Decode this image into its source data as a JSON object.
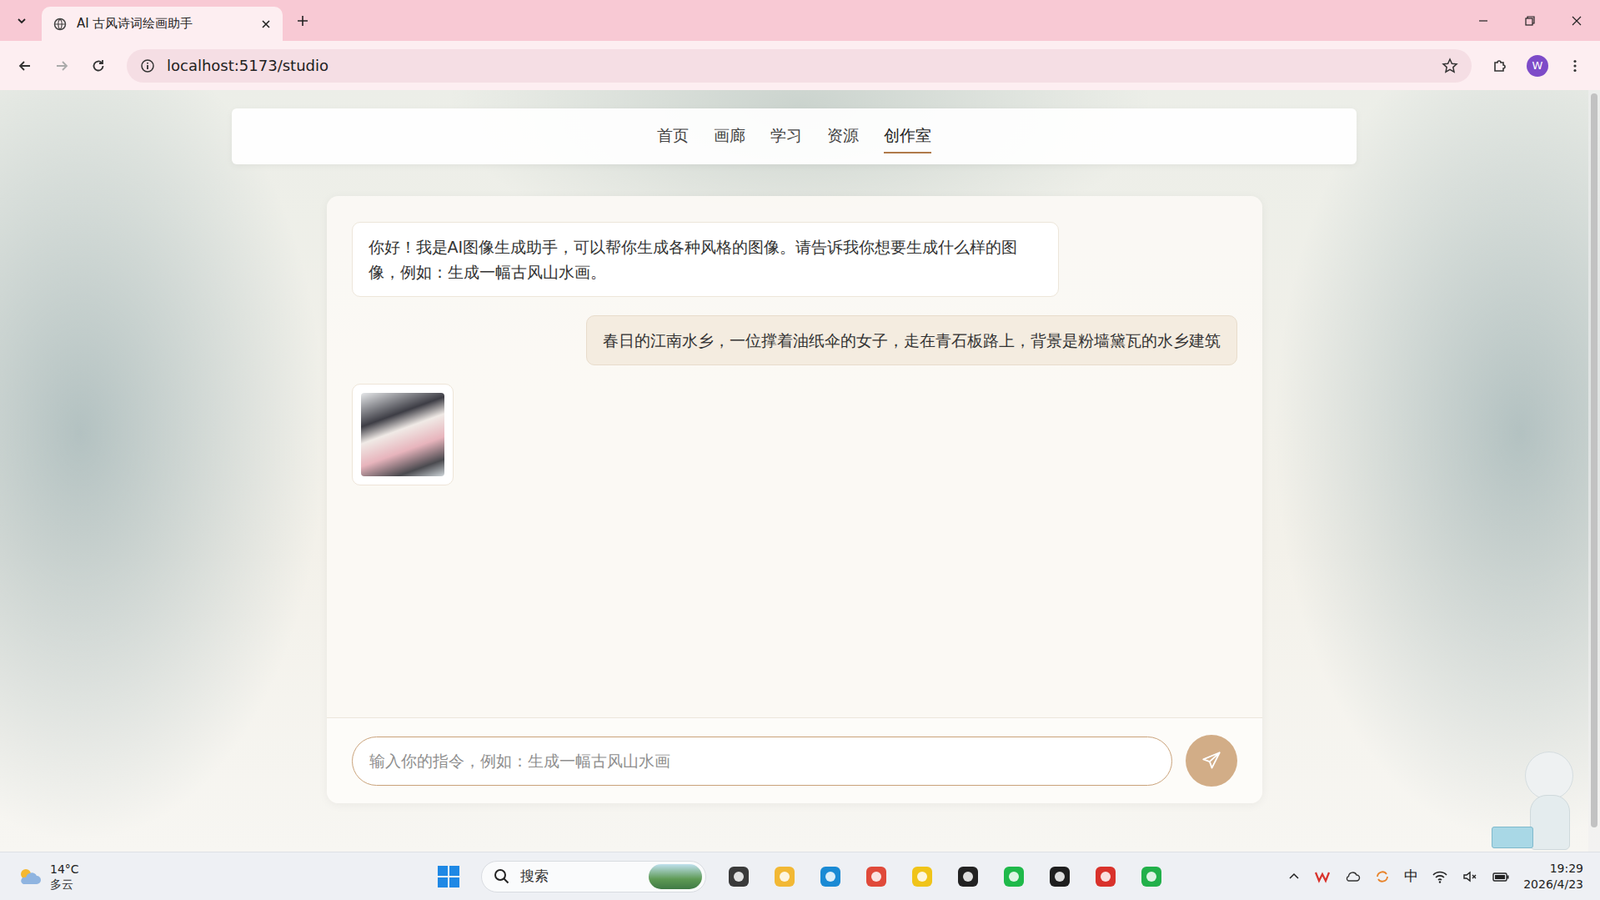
{
  "window": {
    "title": "AI 古风诗词绘画助手"
  },
  "browser": {
    "url": "localhost:5173/studio",
    "profile": "W"
  },
  "nav": {
    "items": [
      {
        "label": "首页",
        "selected": false
      },
      {
        "label": "画廊",
        "selected": false
      },
      {
        "label": "学习",
        "selected": false
      },
      {
        "label": "资源",
        "selected": false
      },
      {
        "label": "创作室",
        "selected": true
      }
    ]
  },
  "chat": {
    "messages": [
      {
        "kind": "text",
        "role": "assistant",
        "text": "你好！我是AI图像生成助手，可以帮你生成各种风格的图像。请告诉我你想要生成什么样的图像，例如：生成一幅古风山水画。"
      },
      {
        "kind": "text",
        "role": "user",
        "text": "春日的江南水乡，一位撑着油纸伞的女子，走在青石板路上，背景是粉墙黛瓦的水乡建筑"
      },
      {
        "kind": "image",
        "role": "assistant"
      }
    ],
    "input": {
      "placeholder": "输入你的指令，例如：生成一幅古风山水画"
    }
  },
  "taskbar": {
    "weather": {
      "temp": "14°C",
      "condition": "多云"
    },
    "search": {
      "placeholder": "搜索"
    },
    "ime": "中",
    "time": "19:29",
    "date": "2026/4/23"
  }
}
